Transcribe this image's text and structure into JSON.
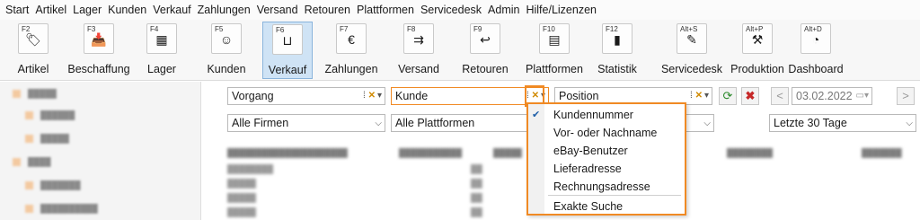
{
  "menu": [
    "Start",
    "Artikel",
    "Lager",
    "Kunden",
    "Verkauf",
    "Zahlungen",
    "Versand",
    "Retouren",
    "Plattformen",
    "Servicedesk",
    "Admin",
    "Hilfe/Lizenzen"
  ],
  "ribbon": [
    {
      "key": "F2",
      "label": "Artikel",
      "icon": "tag-icon",
      "sym": "🏷"
    },
    {
      "key": "F3",
      "label": "Beschaffung",
      "icon": "procurement-icon",
      "sym": "📥"
    },
    {
      "key": "F4",
      "label": "Lager",
      "icon": "warehouse-icon",
      "sym": "▦"
    },
    {
      "key": "F5",
      "label": "Kunden",
      "icon": "customer-icon",
      "sym": "☺"
    },
    {
      "key": "F6",
      "label": "Verkauf",
      "icon": "cart-icon",
      "sym": "⊔",
      "active": true
    },
    {
      "key": "F7",
      "label": "Zahlungen",
      "icon": "payment-icon",
      "sym": "€"
    },
    {
      "key": "F8",
      "label": "Versand",
      "icon": "shipping-icon",
      "sym": "⇉"
    },
    {
      "key": "F9",
      "label": "Retouren",
      "icon": "return-icon",
      "sym": "↩"
    },
    {
      "key": "F10",
      "label": "Plattformen",
      "icon": "platform-icon",
      "sym": "▤"
    },
    {
      "key": "F12",
      "label": "Statistik",
      "icon": "statistics-icon",
      "sym": "▮"
    },
    {
      "key": "Alt+S",
      "label": "Servicedesk",
      "icon": "servicedesk-icon",
      "sym": "✎"
    },
    {
      "key": "Alt+P",
      "label": "Produktion",
      "icon": "production-icon",
      "sym": "⚒"
    },
    {
      "key": "Alt+D",
      "label": "Dashboard",
      "icon": "dashboard-icon",
      "sym": "◔"
    }
  ],
  "filters": {
    "vorgang": "Vorgang",
    "kunde": "Kunde",
    "position": "Position",
    "date": "03.02.2022",
    "firmen": "Alle Firmen",
    "plattformen": "Alle Plattformen",
    "zeitraum": "Letzte 30 Tage"
  },
  "dropdown": {
    "items": [
      {
        "label": "Kundennummer",
        "checked": true
      },
      {
        "label": "Vor- oder Nachname",
        "checked": false
      },
      {
        "label": "eBay-Benutzer",
        "checked": false
      },
      {
        "label": "Lieferadresse",
        "checked": false
      },
      {
        "label": "Rechnungsadresse",
        "checked": false
      }
    ],
    "exact": "Exakte Suche"
  },
  "colors": {
    "highlight": "#f08a24",
    "active_tab": "#cfe3f5",
    "refresh": "#2e8b2e",
    "cancel": "#c62828"
  }
}
